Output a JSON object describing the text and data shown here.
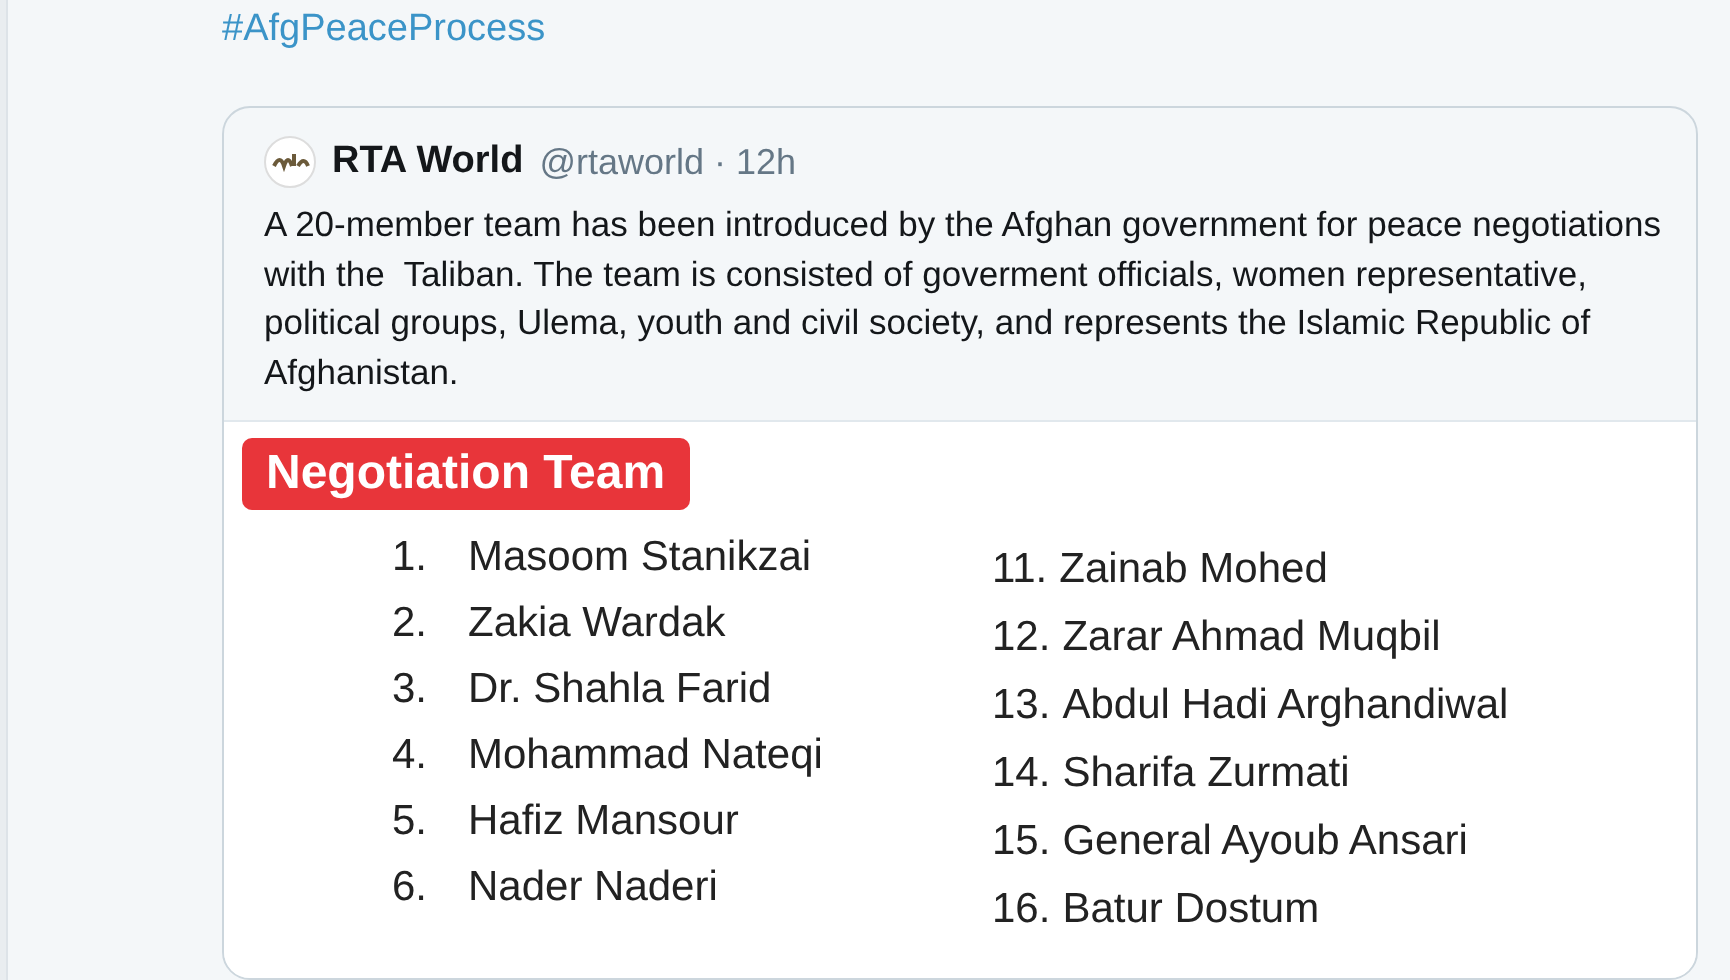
{
  "hashtag": "#AfgPeaceProcess",
  "quoted_tweet": {
    "author": "RTA World",
    "handle": "@rtaworld · 12h",
    "text": "A 20-member team has been introduced by the Afghan government for peace negotiations with the  Taliban. The team is consisted of goverment officials, women representative, political groups, Ulema, youth and civil society, and represents the Islamic Republic of Afghanistan.",
    "image": {
      "title": "Negotiation Team",
      "left_list": [
        {
          "number": "1.",
          "name": "Masoom Stanikzai"
        },
        {
          "number": "2.",
          "name": "Zakia Wardak"
        },
        {
          "number": "3.",
          "name": "Dr. Shahla Farid"
        },
        {
          "number": "4.",
          "name": "Mohammad Nateqi"
        },
        {
          "number": "5.",
          "name": "Hafiz Mansour"
        },
        {
          "number": "6.",
          "name": "Nader Naderi"
        }
      ],
      "right_list": [
        {
          "number": "11.",
          "name": "Zainab Mohed"
        },
        {
          "number": "12.",
          "name": "Zarar Ahmad Muqbil"
        },
        {
          "number": "13.",
          "name": "Abdul Hadi Arghandiwal"
        },
        {
          "number": "14.",
          "name": "Sharifa Zurmati"
        },
        {
          "number": "15.",
          "name": "General Ayoub Ansari"
        },
        {
          "number": "16.",
          "name": "Batur Dostum"
        }
      ]
    }
  }
}
